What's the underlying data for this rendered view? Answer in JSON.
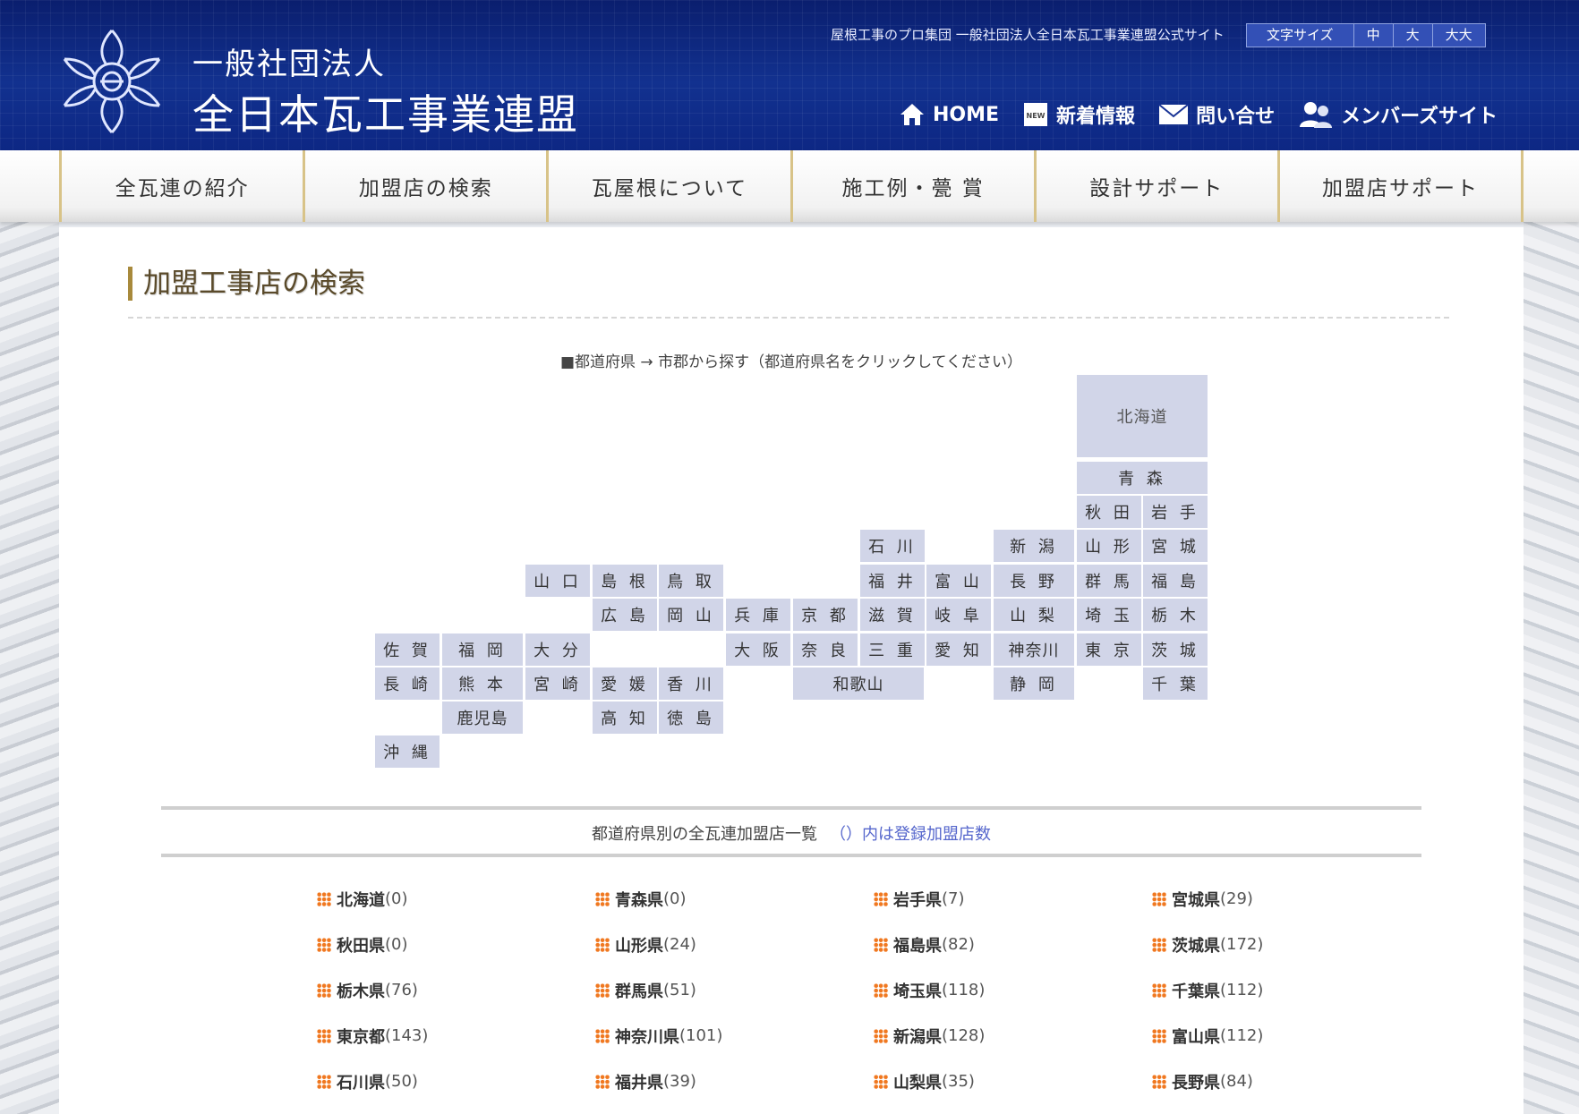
{
  "header": {
    "org_line1": "一般社団法人",
    "org_line2": "全日本瓦工事業連盟",
    "tagline": "屋根工事のプロ集団 一般社団法人全日本瓦工事業連盟公式サイト",
    "font_size": {
      "label": "文字サイズ",
      "medium": "中",
      "large": "大",
      "xlarge": "大大"
    },
    "links": {
      "home": "HOME",
      "news": "新着情報",
      "contact": "問い合せ",
      "members": "メンバーズサイト"
    },
    "news_badge": "NEW"
  },
  "nav": {
    "tabs": [
      "全瓦連の紹介",
      "加盟店の検索",
      "瓦屋根について",
      "施工例・甍 賞",
      "設計サポート",
      "加盟店サポート"
    ]
  },
  "page": {
    "title": "加盟工事店の検索",
    "map_caption": "■都道府県 → 市郡から探す（都道府県名をクリックしてください）"
  },
  "map": {
    "hokkaido": "北海道",
    "aomori": "青 森",
    "akita": "秋 田",
    "iwate": "岩 手",
    "yamagata": "山 形",
    "miyagi": "宮 城",
    "fukushima": "福 島",
    "gunma": "群 馬",
    "saitama": "埼 玉",
    "tochigi": "栃 木",
    "tokyo": "東 京",
    "ibaraki": "茨 城",
    "chiba": "千 葉",
    "niigata": "新 潟",
    "nagano": "長 野",
    "yamanashi": "山 梨",
    "kanagawa": "神奈川",
    "shizuoka": "静 岡",
    "ishikawa": "石 川",
    "fukui": "福 井",
    "toyama": "富 山",
    "shiga": "滋 賀",
    "gifu": "岐 阜",
    "mie": "三 重",
    "aichi": "愛 知",
    "kyoto": "京 都",
    "nara": "奈 良",
    "wakayama": "和歌山",
    "hyogo": "兵 庫",
    "osaka": "大 阪",
    "tottori": "鳥 取",
    "shimane": "島 根",
    "okayama": "岡 山",
    "hiroshima": "広 島",
    "yamaguchi": "山 口",
    "kagawa": "香 川",
    "ehime": "愛 媛",
    "tokushima": "徳 島",
    "kochi": "高 知",
    "fukuoka": "福 岡",
    "saga": "佐 賀",
    "oita": "大 分",
    "nagasaki": "長 崎",
    "kumamoto": "熊 本",
    "miyazaki": "宮 崎",
    "kagoshima": "鹿児島",
    "okinawa": "沖 縄"
  },
  "list": {
    "heading": "都道府県別の全瓦連加盟店一覧",
    "note": "（）内は登録加盟店数",
    "rows": [
      [
        {
          "name": "北海道",
          "count": "(0)"
        },
        {
          "name": "青森県",
          "count": "(0)"
        },
        {
          "name": "岩手県",
          "count": "(7)"
        },
        {
          "name": "宮城県",
          "count": "(29)"
        }
      ],
      [
        {
          "name": "秋田県",
          "count": "(0)"
        },
        {
          "name": "山形県",
          "count": "(24)"
        },
        {
          "name": "福島県",
          "count": "(82)"
        },
        {
          "name": "茨城県",
          "count": "(172)"
        }
      ],
      [
        {
          "name": "栃木県",
          "count": "(76)"
        },
        {
          "name": "群馬県",
          "count": "(51)"
        },
        {
          "name": "埼玉県",
          "count": "(118)"
        },
        {
          "name": "千葉県",
          "count": "(112)"
        }
      ],
      [
        {
          "name": "東京都",
          "count": "(143)"
        },
        {
          "name": "神奈川県",
          "count": "(101)"
        },
        {
          "name": "新潟県",
          "count": "(128)"
        },
        {
          "name": "富山県",
          "count": "(112)"
        }
      ],
      [
        {
          "name": "石川県",
          "count": "(50)"
        },
        {
          "name": "福井県",
          "count": "(39)"
        },
        {
          "name": "山梨県",
          "count": "(35)"
        },
        {
          "name": "長野県",
          "count": "(84)"
        }
      ]
    ]
  }
}
